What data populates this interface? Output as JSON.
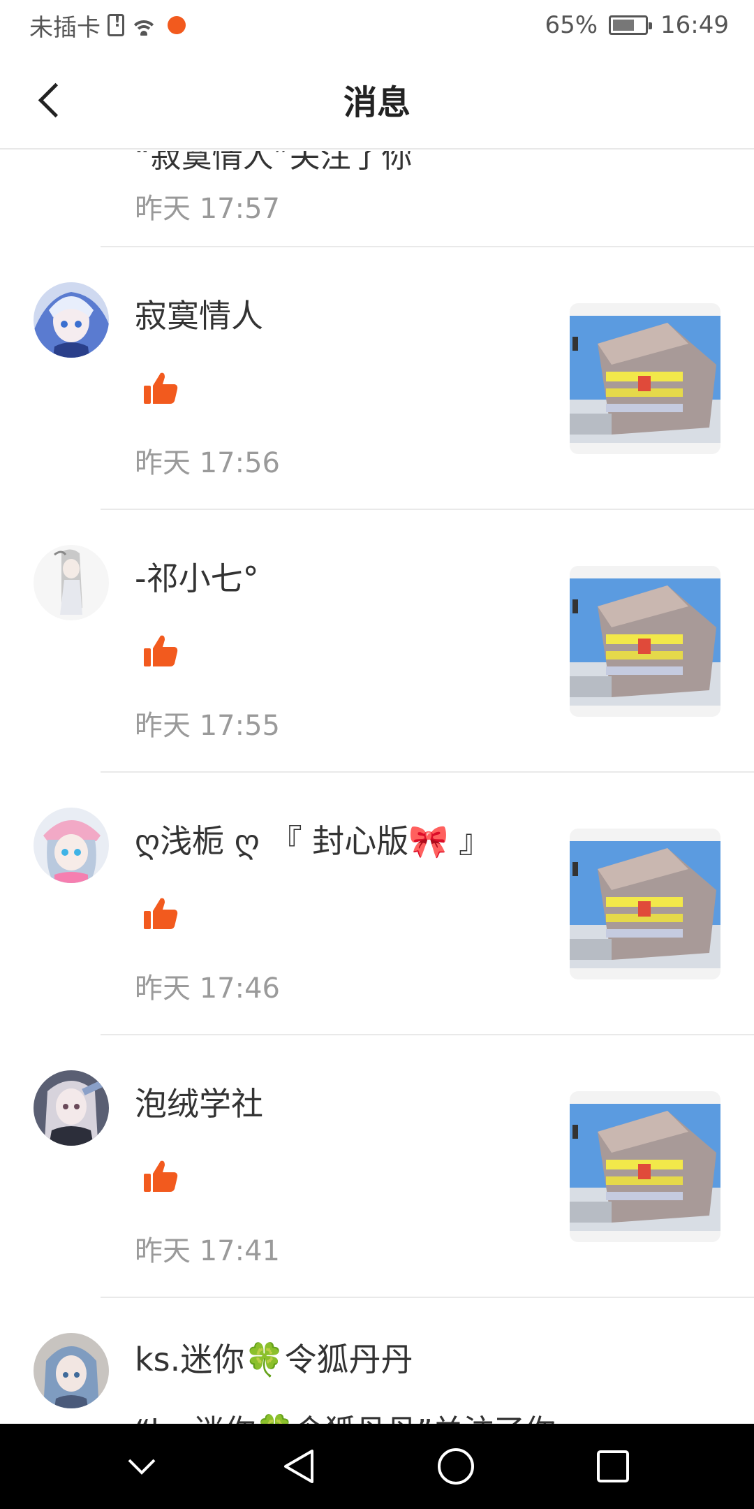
{
  "status_bar": {
    "carrier": "未插卡",
    "battery": "65%",
    "time": "16:49"
  },
  "header": {
    "title": "消息",
    "back_icon": "chevron-left-icon"
  },
  "partial_top": {
    "text": "“寂寞情人”关注了你",
    "time": "昨天 17:57"
  },
  "messages": [
    {
      "user": "寂寞情人",
      "time": "昨天 17:56",
      "action_icon": "thumbs-up-icon"
    },
    {
      "user": "-祁小七°",
      "time": "昨天 17:55",
      "action_icon": "thumbs-up-icon"
    },
    {
      "user": "ღ浅栀 ღ 『 封心版🎀 』",
      "time": "昨天 17:46",
      "action_icon": "thumbs-up-icon"
    },
    {
      "user": "泡绒学社",
      "time": "昨天 17:41",
      "action_icon": "thumbs-up-icon"
    }
  ],
  "partial_bottom": {
    "user": "ks.迷你🍀令狐丹丹",
    "preview": "“ks.迷你🍀令狐丹丹”关注了你"
  },
  "colors": {
    "accent": "#f25a1e",
    "time_text": "#9a9a9a",
    "divider": "#e9e9e9"
  }
}
